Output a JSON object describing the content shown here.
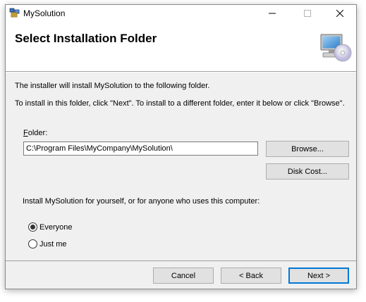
{
  "window": {
    "title": "MySolution",
    "controls": {
      "minimize": "minimize",
      "maximize": "maximize",
      "close": "close"
    }
  },
  "header": {
    "title": "Select Installation Folder",
    "icon": "computer-cd-icon"
  },
  "body": {
    "intro": "The installer will install MySolution to the following folder.",
    "instruction": "To install in this folder, click \"Next\". To install to a different folder, enter it below or click \"Browse\".",
    "folder_label_underlined": "F",
    "folder_label_rest": "older:",
    "folder_value": "C:\\Program Files\\MyCompany\\MySolution\\",
    "browse_label": "Browse...",
    "disk_cost_label": "Disk Cost...",
    "scope_question": "Install MySolution for yourself, or for anyone who uses this computer:",
    "options": [
      {
        "label": "Everyone",
        "selected": true
      },
      {
        "label": "Just me",
        "selected": false
      }
    ]
  },
  "footer": {
    "cancel_label": "Cancel",
    "back_label": "< Back",
    "next_label": "Next >"
  },
  "colors": {
    "dialog_bg": "#f0f0f0",
    "header_bg": "#ffffff",
    "default_button_border": "#0078d7"
  }
}
